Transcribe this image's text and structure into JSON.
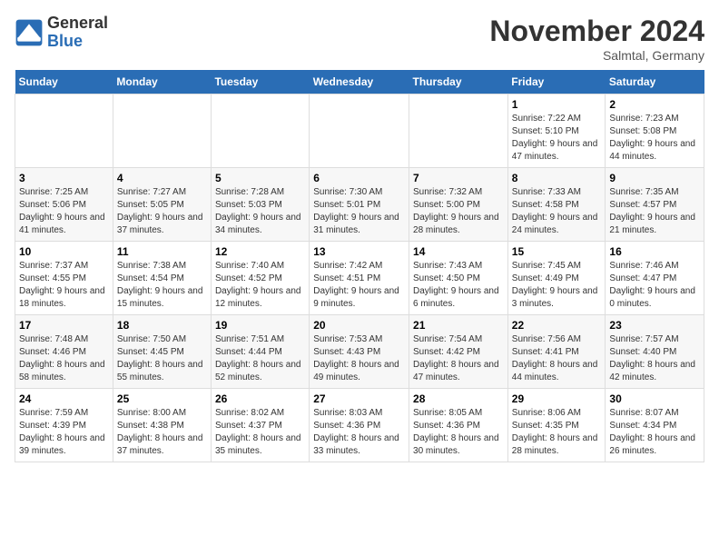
{
  "logo": {
    "general": "General",
    "blue": "Blue"
  },
  "title": "November 2024",
  "location": "Salmtal, Germany",
  "days_header": [
    "Sunday",
    "Monday",
    "Tuesday",
    "Wednesday",
    "Thursday",
    "Friday",
    "Saturday"
  ],
  "weeks": [
    [
      {
        "day": "",
        "info": ""
      },
      {
        "day": "",
        "info": ""
      },
      {
        "day": "",
        "info": ""
      },
      {
        "day": "",
        "info": ""
      },
      {
        "day": "",
        "info": ""
      },
      {
        "day": "1",
        "info": "Sunrise: 7:22 AM\nSunset: 5:10 PM\nDaylight: 9 hours and 47 minutes."
      },
      {
        "day": "2",
        "info": "Sunrise: 7:23 AM\nSunset: 5:08 PM\nDaylight: 9 hours and 44 minutes."
      }
    ],
    [
      {
        "day": "3",
        "info": "Sunrise: 7:25 AM\nSunset: 5:06 PM\nDaylight: 9 hours and 41 minutes."
      },
      {
        "day": "4",
        "info": "Sunrise: 7:27 AM\nSunset: 5:05 PM\nDaylight: 9 hours and 37 minutes."
      },
      {
        "day": "5",
        "info": "Sunrise: 7:28 AM\nSunset: 5:03 PM\nDaylight: 9 hours and 34 minutes."
      },
      {
        "day": "6",
        "info": "Sunrise: 7:30 AM\nSunset: 5:01 PM\nDaylight: 9 hours and 31 minutes."
      },
      {
        "day": "7",
        "info": "Sunrise: 7:32 AM\nSunset: 5:00 PM\nDaylight: 9 hours and 28 minutes."
      },
      {
        "day": "8",
        "info": "Sunrise: 7:33 AM\nSunset: 4:58 PM\nDaylight: 9 hours and 24 minutes."
      },
      {
        "day": "9",
        "info": "Sunrise: 7:35 AM\nSunset: 4:57 PM\nDaylight: 9 hours and 21 minutes."
      }
    ],
    [
      {
        "day": "10",
        "info": "Sunrise: 7:37 AM\nSunset: 4:55 PM\nDaylight: 9 hours and 18 minutes."
      },
      {
        "day": "11",
        "info": "Sunrise: 7:38 AM\nSunset: 4:54 PM\nDaylight: 9 hours and 15 minutes."
      },
      {
        "day": "12",
        "info": "Sunrise: 7:40 AM\nSunset: 4:52 PM\nDaylight: 9 hours and 12 minutes."
      },
      {
        "day": "13",
        "info": "Sunrise: 7:42 AM\nSunset: 4:51 PM\nDaylight: 9 hours and 9 minutes."
      },
      {
        "day": "14",
        "info": "Sunrise: 7:43 AM\nSunset: 4:50 PM\nDaylight: 9 hours and 6 minutes."
      },
      {
        "day": "15",
        "info": "Sunrise: 7:45 AM\nSunset: 4:49 PM\nDaylight: 9 hours and 3 minutes."
      },
      {
        "day": "16",
        "info": "Sunrise: 7:46 AM\nSunset: 4:47 PM\nDaylight: 9 hours and 0 minutes."
      }
    ],
    [
      {
        "day": "17",
        "info": "Sunrise: 7:48 AM\nSunset: 4:46 PM\nDaylight: 8 hours and 58 minutes."
      },
      {
        "day": "18",
        "info": "Sunrise: 7:50 AM\nSunset: 4:45 PM\nDaylight: 8 hours and 55 minutes."
      },
      {
        "day": "19",
        "info": "Sunrise: 7:51 AM\nSunset: 4:44 PM\nDaylight: 8 hours and 52 minutes."
      },
      {
        "day": "20",
        "info": "Sunrise: 7:53 AM\nSunset: 4:43 PM\nDaylight: 8 hours and 49 minutes."
      },
      {
        "day": "21",
        "info": "Sunrise: 7:54 AM\nSunset: 4:42 PM\nDaylight: 8 hours and 47 minutes."
      },
      {
        "day": "22",
        "info": "Sunrise: 7:56 AM\nSunset: 4:41 PM\nDaylight: 8 hours and 44 minutes."
      },
      {
        "day": "23",
        "info": "Sunrise: 7:57 AM\nSunset: 4:40 PM\nDaylight: 8 hours and 42 minutes."
      }
    ],
    [
      {
        "day": "24",
        "info": "Sunrise: 7:59 AM\nSunset: 4:39 PM\nDaylight: 8 hours and 39 minutes."
      },
      {
        "day": "25",
        "info": "Sunrise: 8:00 AM\nSunset: 4:38 PM\nDaylight: 8 hours and 37 minutes."
      },
      {
        "day": "26",
        "info": "Sunrise: 8:02 AM\nSunset: 4:37 PM\nDaylight: 8 hours and 35 minutes."
      },
      {
        "day": "27",
        "info": "Sunrise: 8:03 AM\nSunset: 4:36 PM\nDaylight: 8 hours and 33 minutes."
      },
      {
        "day": "28",
        "info": "Sunrise: 8:05 AM\nSunset: 4:36 PM\nDaylight: 8 hours and 30 minutes."
      },
      {
        "day": "29",
        "info": "Sunrise: 8:06 AM\nSunset: 4:35 PM\nDaylight: 8 hours and 28 minutes."
      },
      {
        "day": "30",
        "info": "Sunrise: 8:07 AM\nSunset: 4:34 PM\nDaylight: 8 hours and 26 minutes."
      }
    ]
  ]
}
